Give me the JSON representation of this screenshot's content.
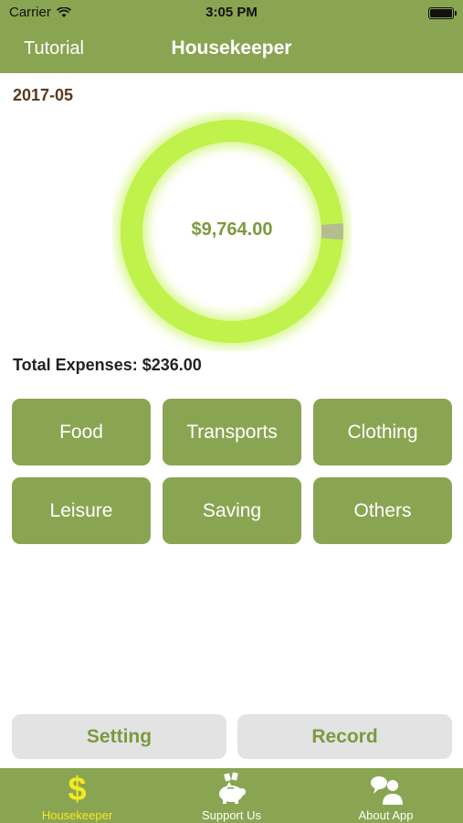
{
  "status_bar": {
    "carrier": "Carrier",
    "time": "3:05 PM"
  },
  "nav": {
    "left_label": "Tutorial",
    "title": "Housekeeper"
  },
  "summary": {
    "month": "2017-05",
    "balance": "$9,764.00",
    "total_expenses": "Total Expenses: $236.00",
    "ring": {
      "spent_fraction": 0.024,
      "remaining_color": "#bff24a",
      "spent_color": "#b3bd8e"
    }
  },
  "categories": [
    "Food",
    "Transports",
    "Clothing",
    "Leisure",
    "Saving",
    "Others"
  ],
  "actions": {
    "setting_label": "Setting",
    "record_label": "Record"
  },
  "tabs": [
    {
      "label": "Housekeeper",
      "icon": "dollar-icon",
      "active": true
    },
    {
      "label": "Support Us",
      "icon": "piggy-bank-icon",
      "active": false
    },
    {
      "label": "About App",
      "icon": "people-chat-icon",
      "active": false
    }
  ],
  "colors": {
    "brand_green": "#8aa552",
    "active_tab": "#f5ea1e",
    "month_text": "#5a3a1e",
    "balance_text": "#7c9a3e"
  }
}
